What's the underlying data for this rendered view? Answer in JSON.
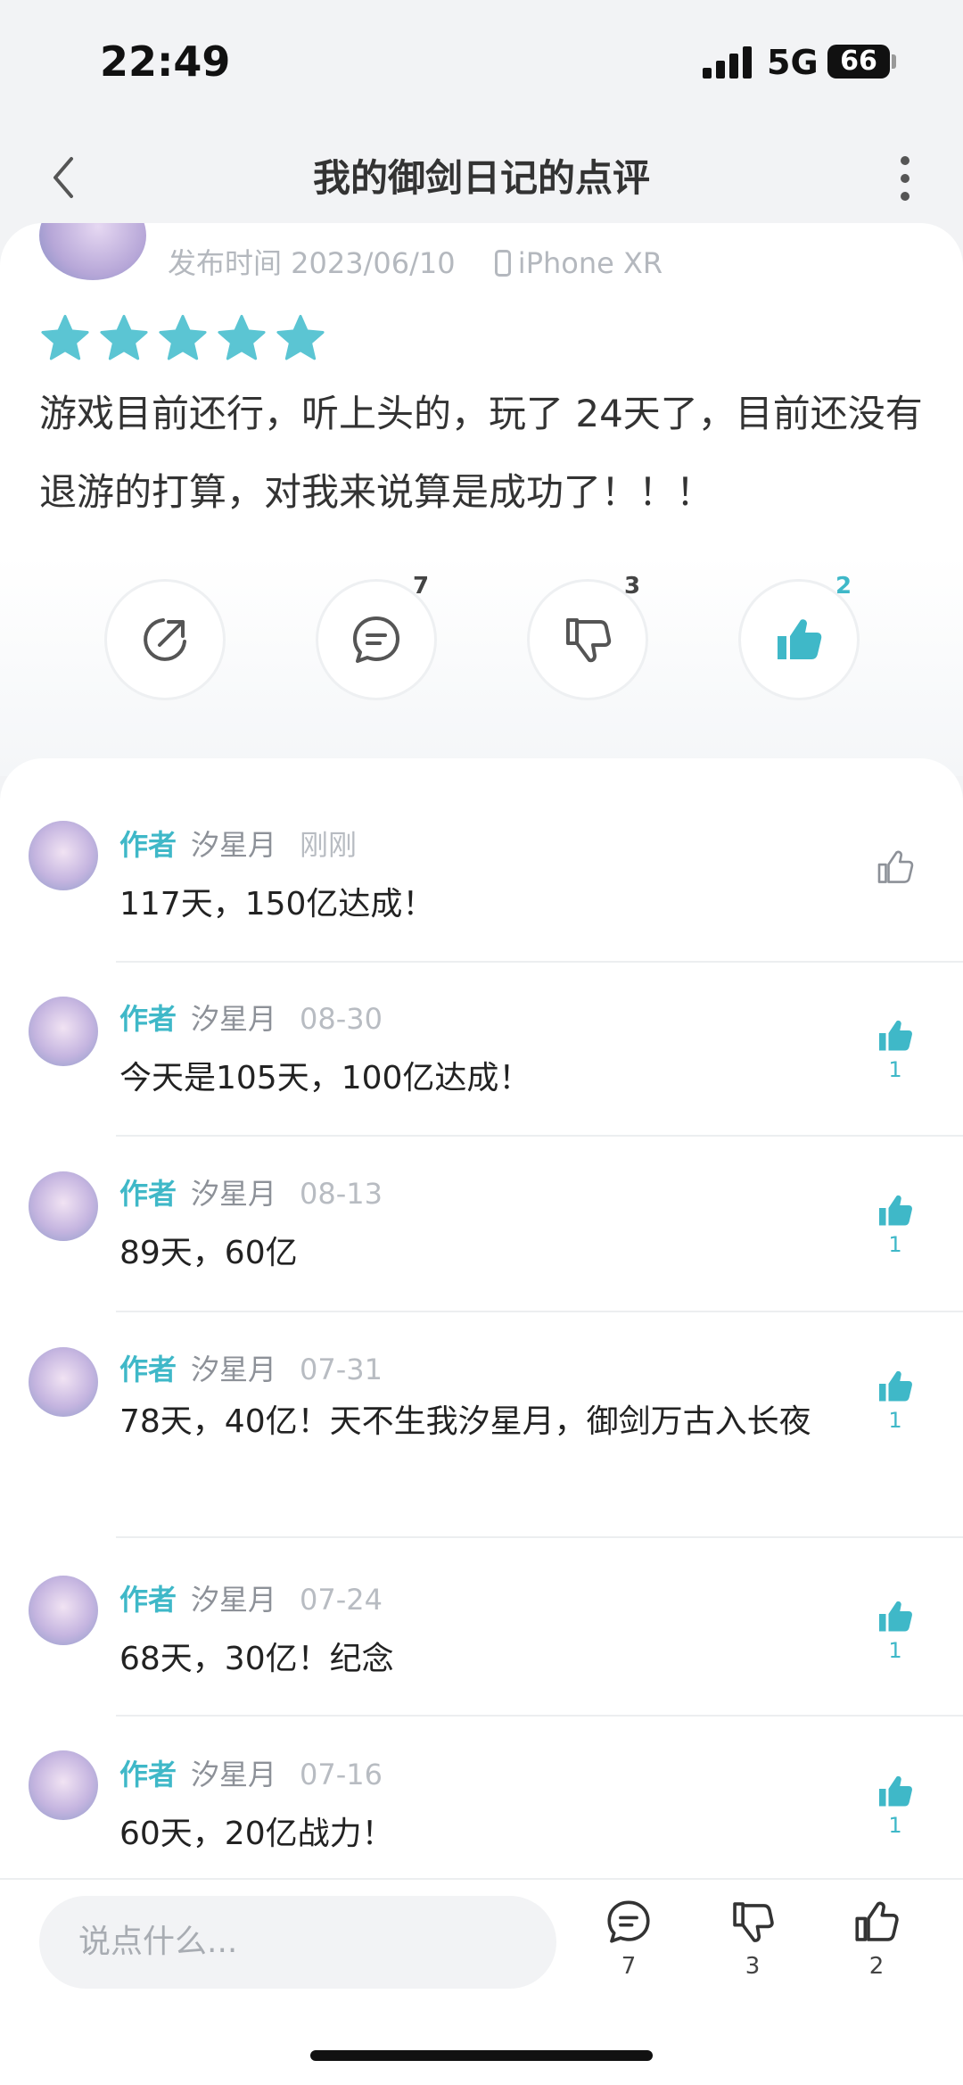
{
  "status_bar": {
    "time": "22:49",
    "network": "5G",
    "battery": "66"
  },
  "nav": {
    "title": "我的御剑日记的点评"
  },
  "review": {
    "publish_label": "发布时间 2023/06/10",
    "device": "iPhone XR",
    "rating": 5,
    "text": "游戏目前还行，听上头的，玩了 24天了，目前还没有退游的打算，对我来说算是成功了！！！",
    "comments_count": "7",
    "dislikes_count": "3",
    "likes_count": "2"
  },
  "comments": [
    {
      "tag": "作者",
      "name": "汐星月",
      "time": "刚刚",
      "text": "117天，150亿达成！",
      "likes": ""
    },
    {
      "tag": "作者",
      "name": "汐星月",
      "time": "08-30",
      "text": "今天是105天，100亿达成！",
      "likes": "1"
    },
    {
      "tag": "作者",
      "name": "汐星月",
      "time": "08-13",
      "text": "89天，60亿",
      "likes": "1"
    },
    {
      "tag": "作者",
      "name": "汐星月",
      "time": "07-31",
      "text": "78天，40亿！天不生我汐星月，御剑万古入长夜",
      "likes": "1"
    },
    {
      "tag": "作者",
      "name": "汐星月",
      "time": "07-24",
      "text": "68天，30亿！纪念",
      "likes": "1"
    },
    {
      "tag": "作者",
      "name": "汐星月",
      "time": "07-16",
      "text": "60天，20亿战力！",
      "likes": "1"
    }
  ],
  "bottom_bar": {
    "input_placeholder": "说点什么...",
    "comments_count": "7",
    "dislikes_count": "3",
    "likes_count": "2"
  },
  "colors": {
    "accent": "#3fb8c8",
    "star": "#5bc5d3",
    "background": "#f2f3f5"
  },
  "icons": [
    "chevron-left-icon",
    "more-vertical-icon",
    "star-icon",
    "share-icon",
    "comment-icon",
    "thumbs-down-icon",
    "thumbs-up-icon",
    "phone-icon"
  ]
}
